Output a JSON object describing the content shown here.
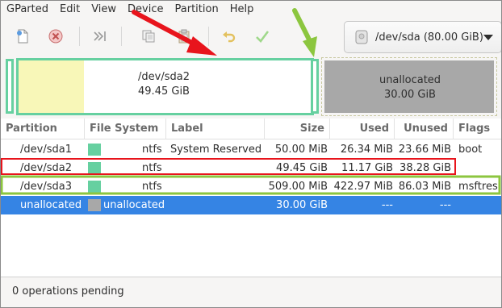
{
  "menu": [
    "GParted",
    "Edit",
    "View",
    "Device",
    "Partition",
    "Help"
  ],
  "toolbar": {
    "icons": [
      "new-icon",
      "delete-icon",
      "resize-move-icon",
      "copy-icon",
      "paste-icon",
      "undo-icon",
      "apply-icon"
    ],
    "device_selector": "/dev/sda (80.00 GiB)"
  },
  "disk_map": {
    "partitions": [
      {
        "name": "/dev/sda2",
        "size": "49.45 GiB"
      },
      {
        "name": "unallocated",
        "size": "30.00 GiB"
      }
    ]
  },
  "table": {
    "columns": [
      "Partition",
      "File System",
      "Label",
      "Size",
      "Used",
      "Unused",
      "Flags"
    ],
    "rows": [
      {
        "partition": "/dev/sda1",
        "fs": "ntfs",
        "label": "System Reserved",
        "size": "50.00 MiB",
        "used": "26.34 MiB",
        "unused": "23.66 MiB",
        "flags": "boot",
        "fs_color": "#66d0a0"
      },
      {
        "partition": "/dev/sda2",
        "fs": "ntfs",
        "label": "",
        "size": "49.45 GiB",
        "used": "11.17 GiB",
        "unused": "38.28 GiB",
        "flags": "",
        "fs_color": "#66d0a0"
      },
      {
        "partition": "/dev/sda3",
        "fs": "ntfs",
        "label": "",
        "size": "509.00 MiB",
        "used": "422.97 MiB",
        "unused": "86.03 MiB",
        "flags": "msftres",
        "fs_color": "#66d0a0"
      },
      {
        "partition": "unallocated",
        "fs": "unallocated",
        "label": "",
        "size": "30.00 GiB",
        "used": "---",
        "unused": "---",
        "flags": "",
        "fs_color": "#a8a8a8"
      }
    ]
  },
  "status": "0 operations pending",
  "colors": {
    "ntfs": "#66d0a0",
    "used_fill": "#f8f7b8",
    "selection": "#3584e4",
    "annotation_red": "#e8141c",
    "annotation_green": "#8cc63f"
  }
}
